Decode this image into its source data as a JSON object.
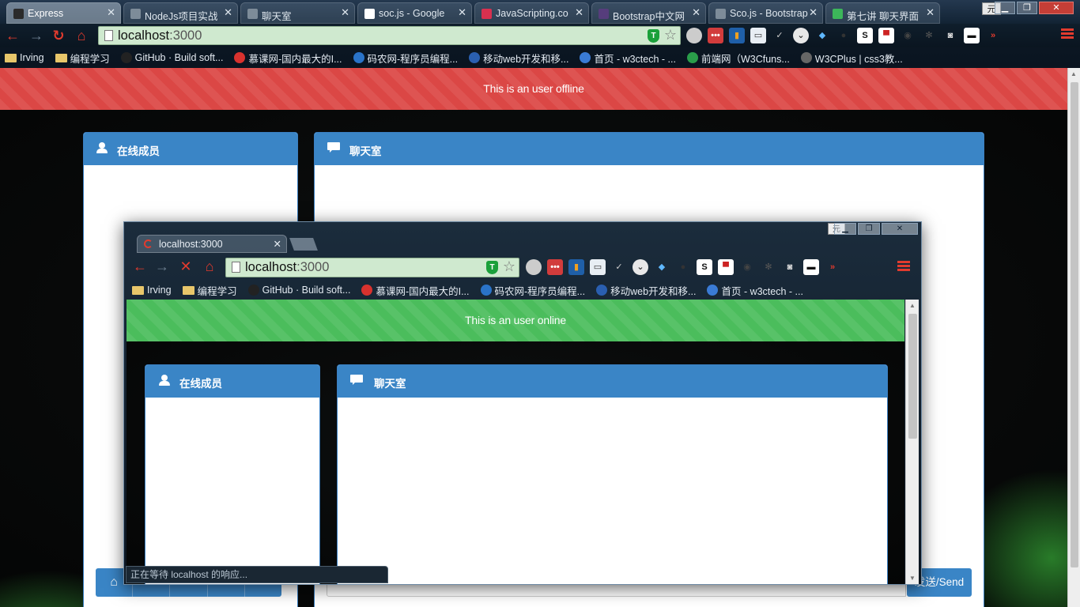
{
  "outer_browser": {
    "tabs": [
      {
        "title": "Express",
        "active": true,
        "favicon_color": "#2b2b2b"
      },
      {
        "title": "NodeJs项目实战",
        "active": false,
        "favicon_color": "#7d8c99"
      },
      {
        "title": "聊天室",
        "active": false,
        "favicon_color": "#7d8c99"
      },
      {
        "title": "soc.js - Google",
        "active": false,
        "favicon_color": "#ffffff"
      },
      {
        "title": "JavaScripting.co",
        "active": false,
        "favicon_color": "#d9304f"
      },
      {
        "title": "Bootstrap中文网",
        "active": false,
        "favicon_color": "#563d7c"
      },
      {
        "title": "Sco.js - Bootstrap",
        "active": false,
        "favicon_color": "#7d8c99"
      },
      {
        "title": "第七讲 聊天界面",
        "active": false,
        "favicon_color": "#3cb65a"
      }
    ],
    "ime_label": "元",
    "address": {
      "host": "localhost",
      "port": ":3000"
    },
    "bookmarks": [
      {
        "label": "Irving",
        "icon": "folder-icon"
      },
      {
        "label": "编程学习",
        "icon": "folder-icon"
      },
      {
        "label": "GitHub · Build soft...",
        "icon": "github-icon"
      },
      {
        "label": "慕课网-国内最大的I...",
        "icon": "imooc-icon"
      },
      {
        "label": "码农网-程序员编程...",
        "icon": "codeceo-icon"
      },
      {
        "label": "移动web开发和移...",
        "icon": "mobile-web-icon"
      },
      {
        "label": "首页 - w3ctech - ...",
        "icon": "w3ctech-icon"
      },
      {
        "label": "前端网（W3Cfuns...",
        "icon": "w3cfuns-icon"
      },
      {
        "label": "W3CPlus | css3教...",
        "icon": "w3cplus-icon"
      }
    ]
  },
  "outer_page": {
    "banner": "This is an user offline",
    "banner_color": "#db4745",
    "members_title": "在线成员",
    "chat_title": "聊天室",
    "send_label": "发送/Send",
    "accent_color": "#3a85c6"
  },
  "popup_browser": {
    "tab_title": "localhost:3000",
    "ime_label": "元",
    "address": {
      "host": "localhost",
      "port": ":3000"
    },
    "bookmarks": [
      {
        "label": "Irving",
        "icon": "folder-icon"
      },
      {
        "label": "编程学习",
        "icon": "folder-icon"
      },
      {
        "label": "GitHub · Build soft...",
        "icon": "github-icon"
      },
      {
        "label": "慕课网-国内最大的I...",
        "icon": "imooc-icon"
      },
      {
        "label": "码农网-程序员编程...",
        "icon": "codeceo-icon"
      },
      {
        "label": "移动web开发和移...",
        "icon": "mobile-web-icon"
      },
      {
        "label": "首页 - w3ctech - ...",
        "icon": "w3ctech-icon"
      }
    ],
    "page": {
      "banner": "This is an user online",
      "banner_color": "#4bbd5c",
      "members_title": "在线成员",
      "chat_title": "聊天室"
    },
    "status_text": "正在等待 localhost 的响应..."
  }
}
